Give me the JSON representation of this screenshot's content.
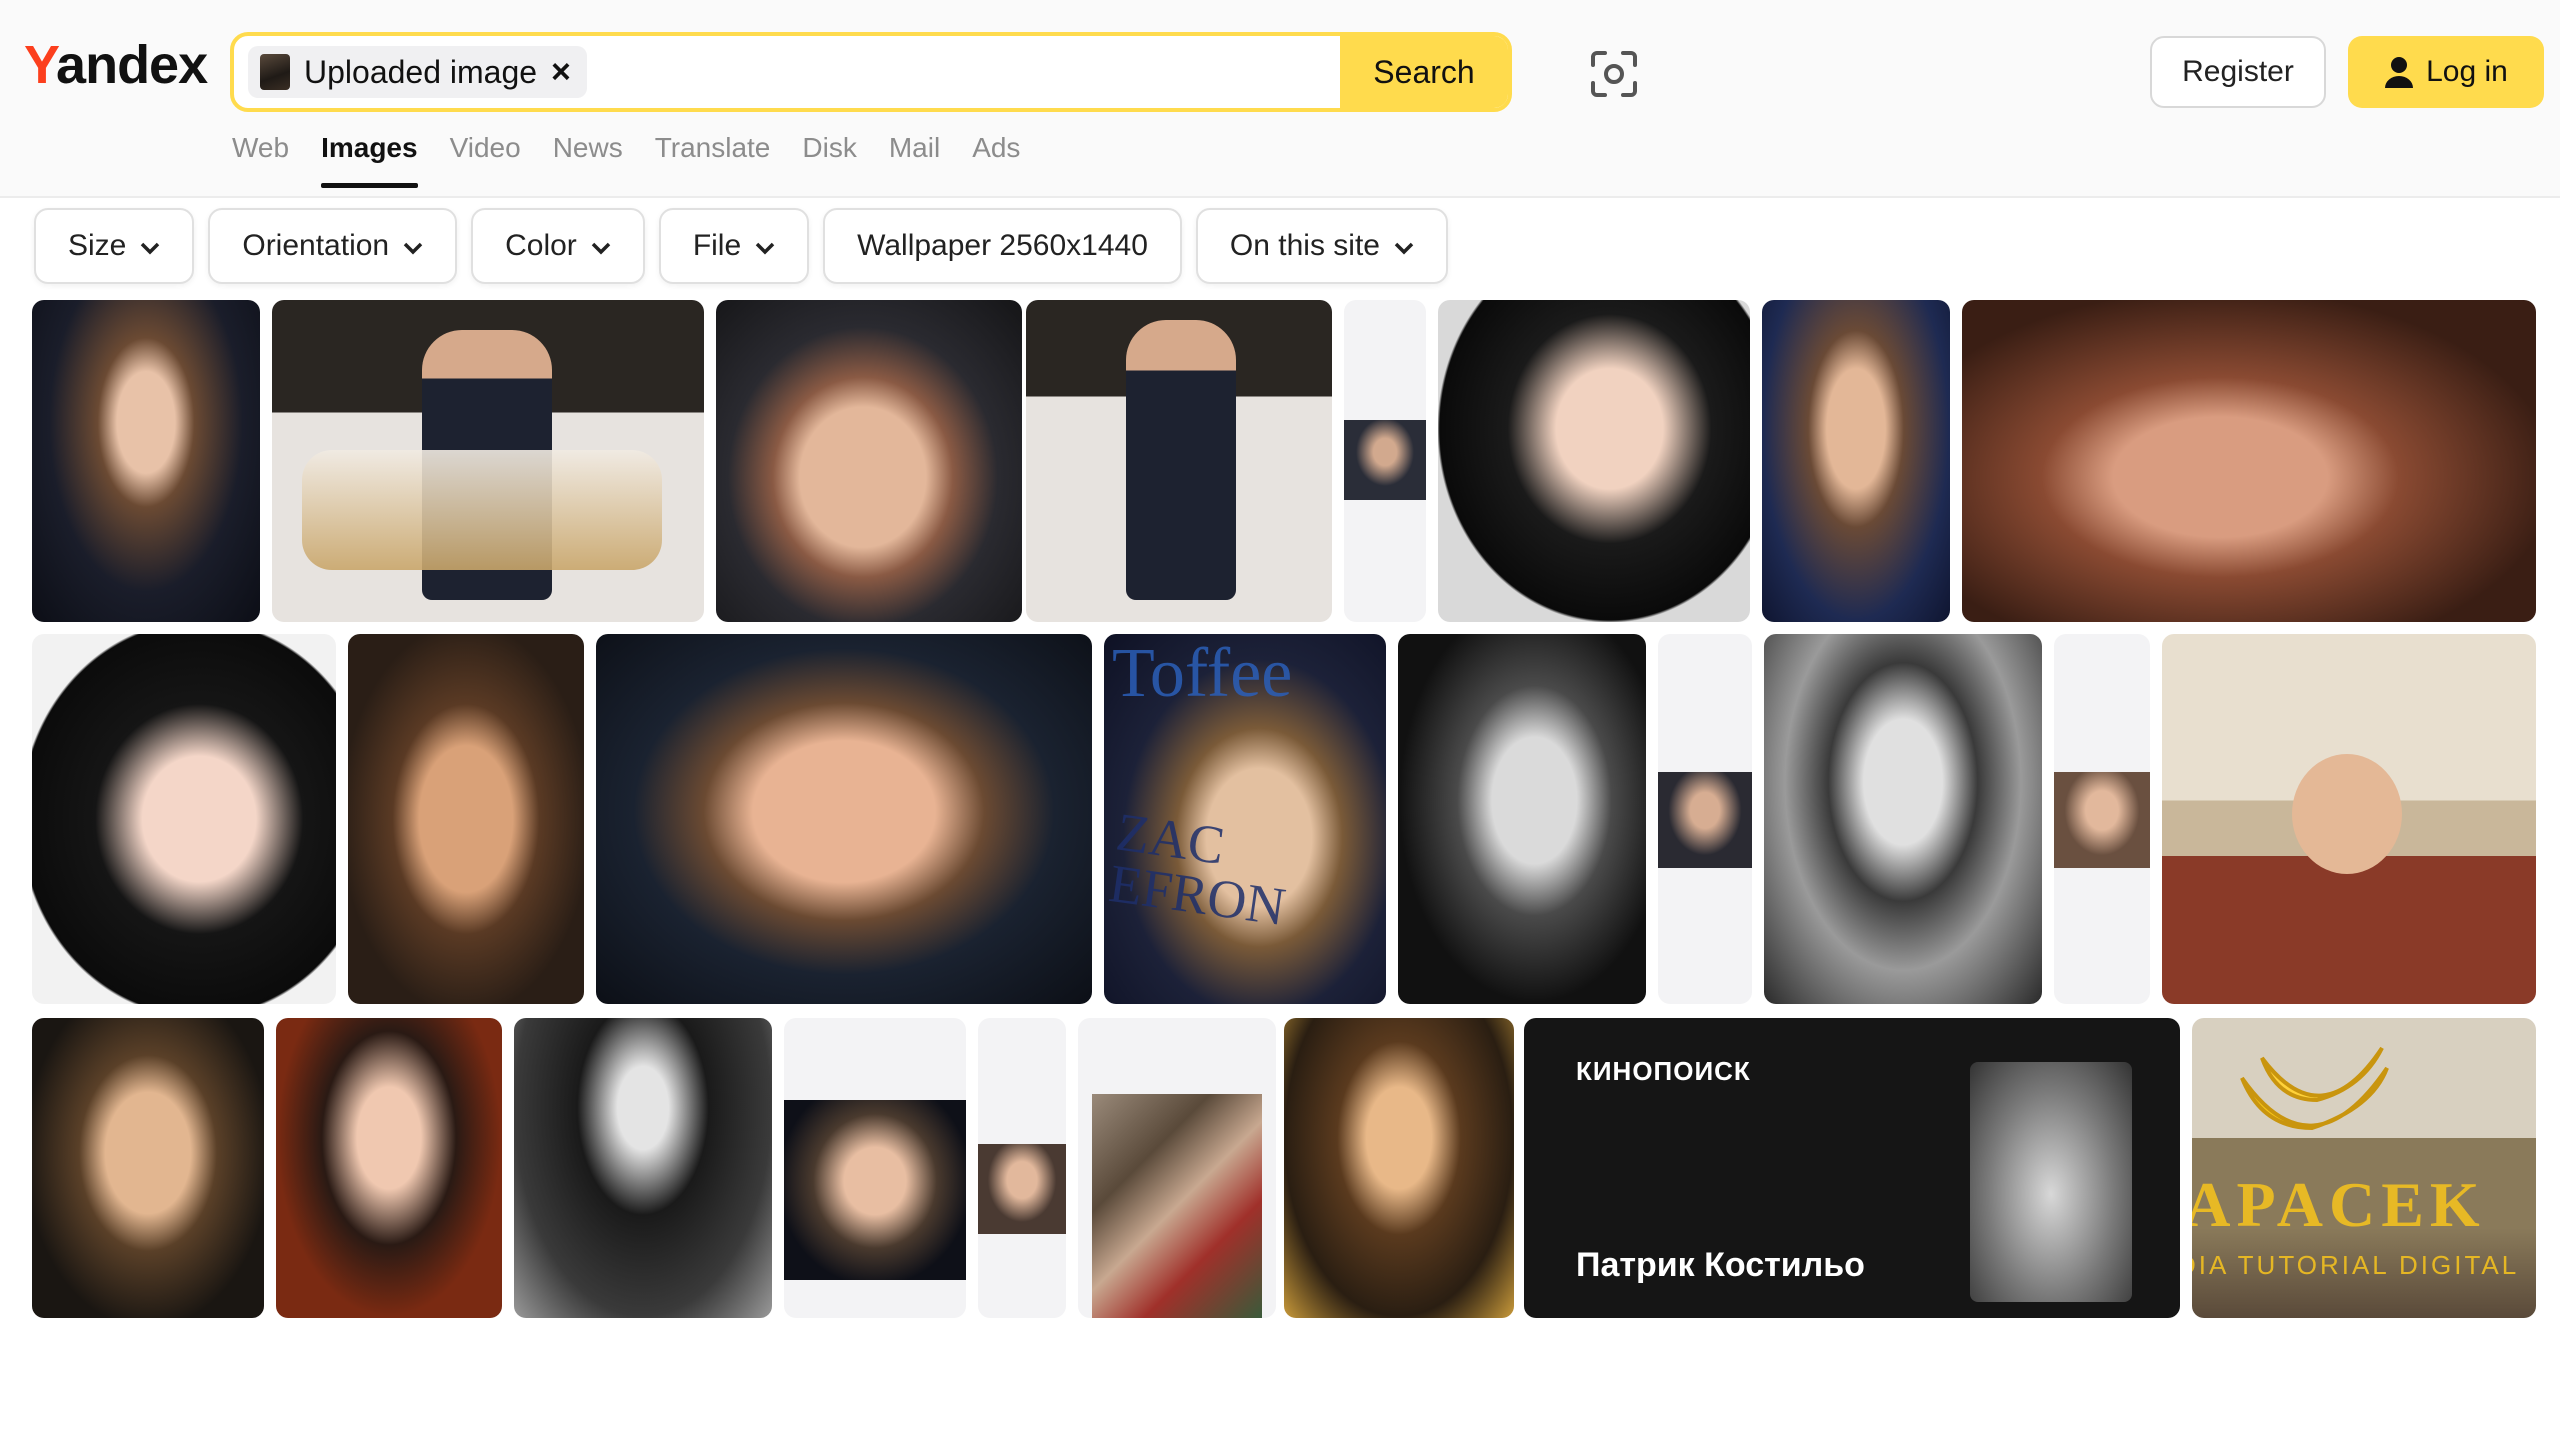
{
  "logo": {
    "first": "Y",
    "rest": "andex"
  },
  "search": {
    "chip_label": "Uploaded image",
    "chip_close": "×",
    "button_label": "Search",
    "query": ""
  },
  "header": {
    "register_label": "Register",
    "login_label": "Log in"
  },
  "tabs": [
    {
      "label": "Web",
      "active": false
    },
    {
      "label": "Images",
      "active": true
    },
    {
      "label": "Video",
      "active": false
    },
    {
      "label": "News",
      "active": false
    },
    {
      "label": "Translate",
      "active": false
    },
    {
      "label": "Disk",
      "active": false
    },
    {
      "label": "Mail",
      "active": false
    },
    {
      "label": "Ads",
      "active": false
    }
  ],
  "filters": [
    {
      "label": "Size",
      "has_dropdown": true
    },
    {
      "label": "Orientation",
      "has_dropdown": true
    },
    {
      "label": "Color",
      "has_dropdown": true
    },
    {
      "label": "File",
      "has_dropdown": true
    },
    {
      "label": "Wallpaper 2560x1440",
      "has_dropdown": false
    },
    {
      "label": "On this site",
      "has_dropdown": true
    }
  ],
  "results": {
    "kinopoisk_brand": "КИНОПОИСК",
    "kinopoisk_name": "Патрик Костильо",
    "magazine_title": "Toffee",
    "magazine_cover_name": "ZAC EFRON",
    "watermark_text": "CAPACEK",
    "watermark_sub": "MEDIA TUTORIAL DIGITAL"
  },
  "colors": {
    "accent": "#ffdb4d",
    "logo_red": "#fc3f1d",
    "tab_inactive": "#8c8c8c"
  }
}
